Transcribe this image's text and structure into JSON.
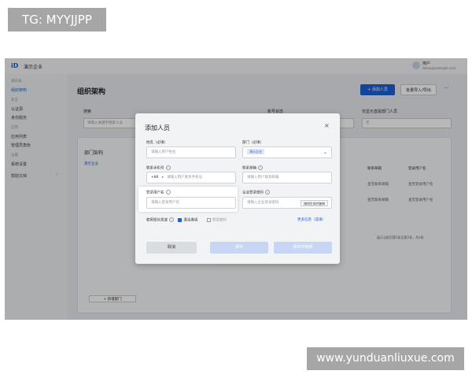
{
  "watermarks": {
    "top_left": "TG: MYYJJPP",
    "bottom_right": "www.yunduanliuxue.com"
  },
  "app": {
    "logo": "iD",
    "brand": "演示企业",
    "user_name": "用户",
    "user_sub": "demo@example.com"
  },
  "sidebar": {
    "items": [
      {
        "label": "通讯录",
        "type": "section"
      },
      {
        "label": "组织架构",
        "type": "item",
        "active": true
      },
      {
        "label": "安全",
        "type": "section"
      },
      {
        "label": "认证源",
        "type": "item"
      },
      {
        "label": "身份服务",
        "type": "item"
      },
      {
        "label": "应用",
        "type": "section"
      },
      {
        "label": "应用列表",
        "type": "item"
      },
      {
        "label": "管理员角色",
        "type": "item"
      },
      {
        "label": "设置",
        "type": "section"
      },
      {
        "label": "系统设置",
        "type": "item"
      },
      {
        "label": "帮助文档",
        "type": "item",
        "badge": "↗"
      }
    ]
  },
  "main": {
    "title": "组织架构",
    "add_button": "+ 添加人员",
    "batch_button": "批量导入/导出",
    "more": "···",
    "filters": [
      {
        "label": "搜索",
        "placeholder": "请输入关键字搜索人员"
      },
      {
        "label": "账号状态",
        "placeholder": ""
      },
      {
        "label": "仅显示直属部门人员",
        "placeholder": "否"
      }
    ],
    "tree_title": "部门架构",
    "tree_root": "演示企业",
    "add_node": "+ 新增部门",
    "columns": [
      "联系邮箱",
      "登录用户名"
    ],
    "rows": [
      [
        "查无联系邮箱",
        "查无登录用户名"
      ],
      [
        "查无联系邮箱",
        "查无登录用户名"
      ]
    ],
    "pager": "展示当前页第1条至第2条，共2条"
  },
  "modal": {
    "title": "添加人员",
    "close": "×",
    "name_label": "姓名（必填）",
    "name_placeholder": "请输入用户姓名",
    "dept_label": "部门（必填）",
    "dept_value": "演示企业",
    "phone_label": "联系手机号",
    "phone_prefix": "+86",
    "phone_placeholder": "请输入用户联系手机号",
    "email_label": "联系邮箱",
    "email_placeholder": "请输入用户联系邮箱",
    "username_label": "登录用户名",
    "username_placeholder": "请输入登录用户名",
    "password_label": "企业登录密码",
    "password_placeholder": "请输入企业登录密码",
    "generate_button": "随机生成并复制",
    "sms_label": "使用短信发送",
    "opt_activate": "激活邀请",
    "opt_password": "登录密码",
    "more_info": "更多信息（选填）",
    "cancel": "取消",
    "save": "保存",
    "save_continue": "保存并继续"
  }
}
